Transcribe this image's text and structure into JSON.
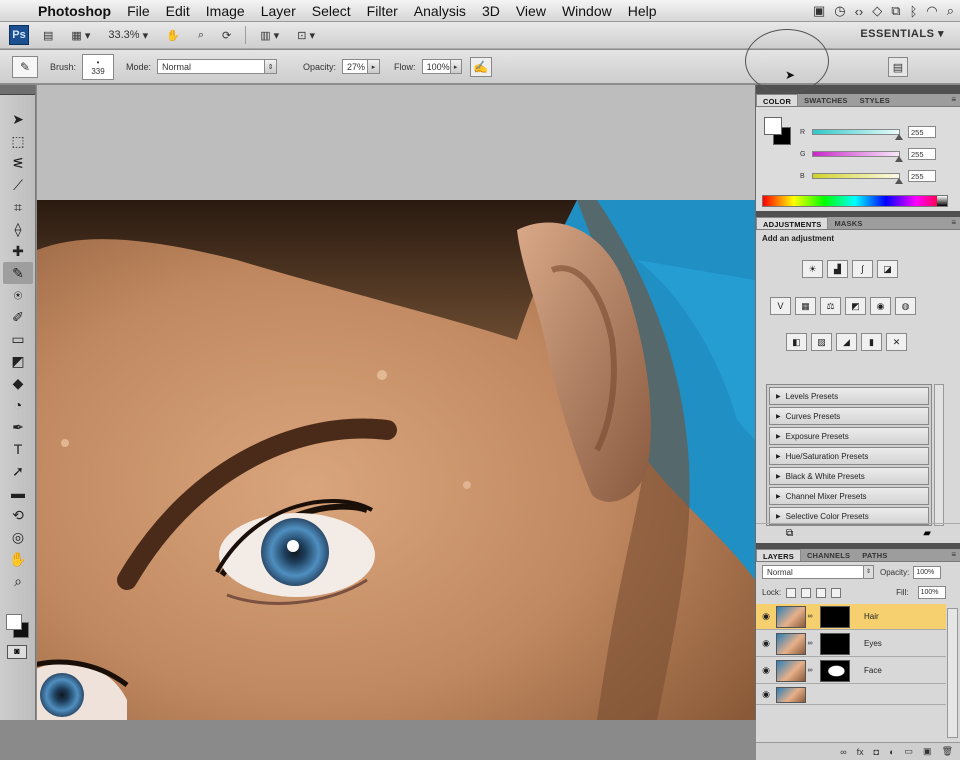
{
  "menubar": {
    "items": [
      "Photoshop",
      "File",
      "Edit",
      "Image",
      "Layer",
      "Select",
      "Filter",
      "Analysis",
      "3D",
      "View",
      "Window",
      "Help"
    ]
  },
  "appbar": {
    "logo": "Ps",
    "zoom": "33.3%",
    "workspace": "ESSENTIALS ▾"
  },
  "options": {
    "brush_label": "Brush:",
    "brush_size": "339",
    "mode_label": "Mode:",
    "mode_value": "Normal",
    "opacity_label": "Opacity:",
    "opacity_value": "27%",
    "flow_label": "Flow:",
    "flow_value": "100%"
  },
  "color_panel": {
    "tabs": [
      "COLOR",
      "SWATCHES",
      "STYLES"
    ],
    "channels": [
      {
        "name": "R",
        "value": "255",
        "track": "#5fd6d2"
      },
      {
        "name": "G",
        "value": "255",
        "track": "#d84ad8"
      },
      {
        "name": "B",
        "value": "255",
        "track": "#d9d94a"
      }
    ]
  },
  "adjustments": {
    "tabs": [
      "ADJUSTMENTS",
      "MASKS"
    ],
    "title": "Add an adjustment",
    "presets": [
      "Levels Presets",
      "Curves Presets",
      "Exposure Presets",
      "Hue/Saturation Presets",
      "Black & White Presets",
      "Channel Mixer Presets",
      "Selective Color Presets"
    ]
  },
  "layers": {
    "tabs": [
      "LAYERS",
      "CHANNELS",
      "PATHS"
    ],
    "blend_mode": "Normal",
    "opacity_label": "Opacity:",
    "opacity_value": "100%",
    "lock_label": "Lock:",
    "fill_label": "Fill:",
    "fill_value": "100%",
    "items": [
      {
        "name": "Hair",
        "selected": true
      },
      {
        "name": "Eyes",
        "selected": false
      },
      {
        "name": "Face",
        "selected": false
      }
    ]
  }
}
